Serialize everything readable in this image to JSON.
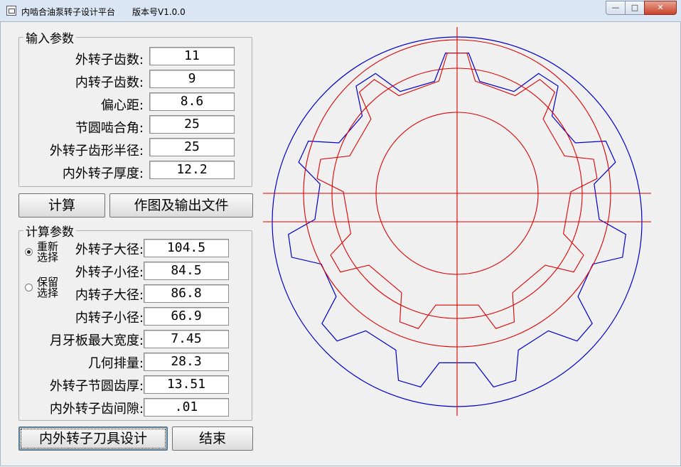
{
  "window": {
    "title": "内啮合油泵转子设计平台",
    "version": "版本号V1.0.0"
  },
  "window_buttons": {
    "minimize": "—",
    "maximize": "□",
    "close": "✕"
  },
  "input_group": {
    "legend": "输入参数",
    "fields": [
      {
        "label": "外转子齿数:",
        "value": "11"
      },
      {
        "label": "内转子齿数:",
        "value": "9"
      },
      {
        "label": "偏心距:",
        "value": "8.6"
      },
      {
        "label": "节圆啮合角:",
        "value": "25"
      },
      {
        "label": "外转子齿形半径:",
        "value": "25"
      },
      {
        "label": "内外转子厚度:",
        "value": "12.2"
      }
    ]
  },
  "buttons": {
    "calc": "计算",
    "plot": "作图及输出文件",
    "tool": "内外转子刀具设计",
    "end": "结束"
  },
  "calc_group": {
    "legend": "计算参数",
    "radio_reselect": "重新选择",
    "radio_keep": "保留选择",
    "fields": [
      {
        "label": "外转子大径:",
        "value": "104.5"
      },
      {
        "label": "外转子小径:",
        "value": "84.5"
      },
      {
        "label": "内转子大径:",
        "value": "86.8"
      },
      {
        "label": "内转子小径:",
        "value": "66.9"
      },
      {
        "label": "月牙板最大宽度:",
        "value": "7.45"
      },
      {
        "label": "几何排量:",
        "value": "28.3"
      },
      {
        "label": "外转子节圆齿厚:",
        "value": "13.51"
      },
      {
        "label": "内外转子齿间隙:",
        "value": ".01"
      }
    ]
  },
  "drawing": {
    "outer_color": "#0000cc",
    "inner_color": "#dd0000",
    "outer_rotor_teeth": 11,
    "inner_rotor_teeth": 9
  }
}
